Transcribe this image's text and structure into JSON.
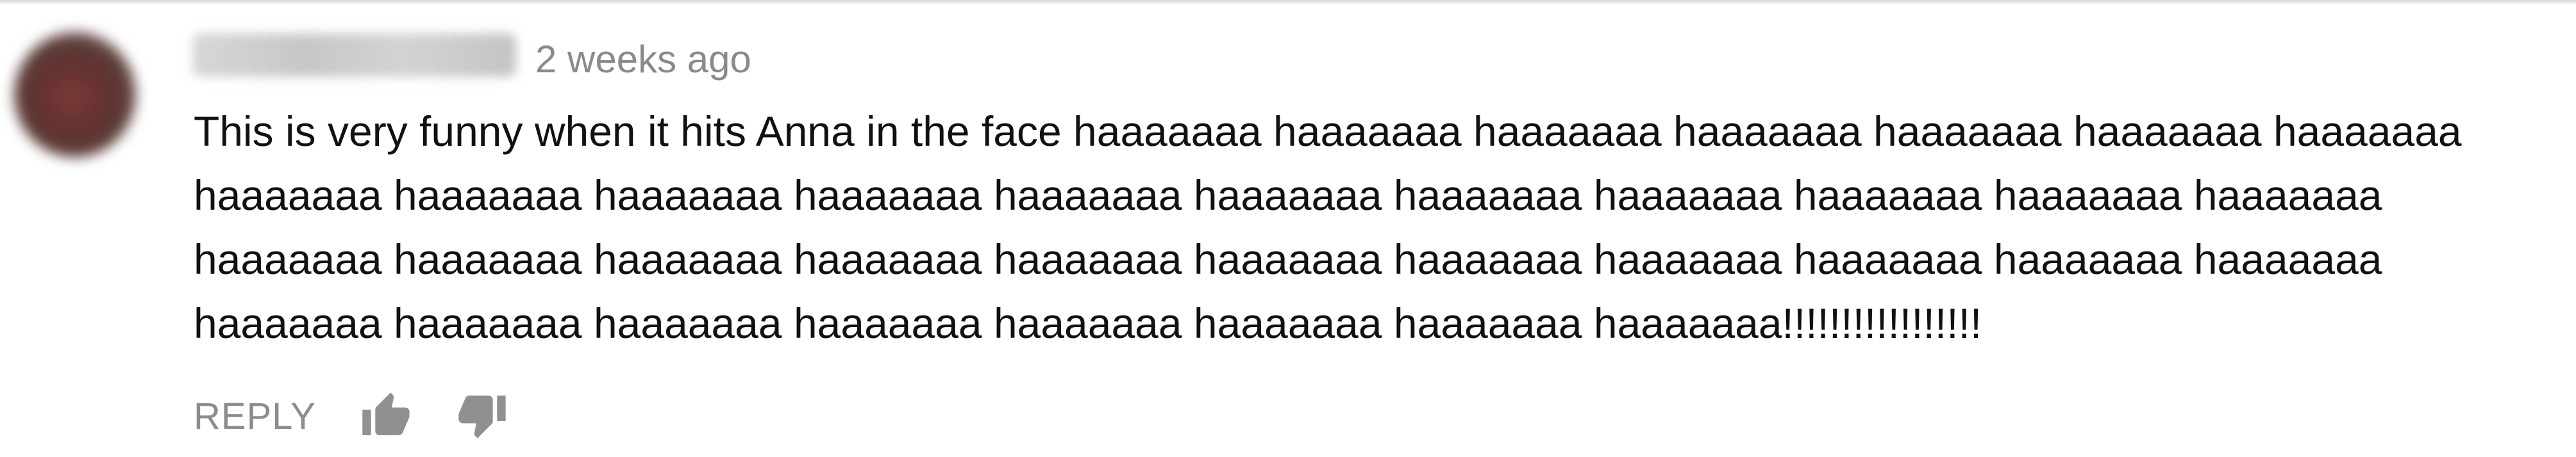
{
  "comment": {
    "timestamp": "2 weeks ago",
    "text_lines": [
      "This is very funny when it hits Anna in the face haaaaaaa haaaaaaa haaaaaaa haaaaaaa haaaaaaa haaaaaaa haaaaaaa",
      "haaaaaaa haaaaaaa haaaaaaa haaaaaaa haaaaaaa haaaaaaa haaaaaaa haaaaaaa haaaaaaa haaaaaaa haaaaaaa",
      "haaaaaaa haaaaaaa haaaaaaa haaaaaaa haaaaaaa haaaaaaa haaaaaaa haaaaaaa haaaaaaa haaaaaaa haaaaaaa",
      "haaaaaaa haaaaaaa haaaaaaa haaaaaaa haaaaaaa haaaaaaa haaaaaaa haaaaaaa!!!!!!!!!!!!!!!!!"
    ],
    "reply_label": "REPLY",
    "icons": {
      "like": "thumb-up-icon",
      "dislike": "thumb-down-icon"
    },
    "colors": {
      "text": "#111111",
      "meta": "#8a8a8a",
      "action": "#8c8c8c",
      "icon": "#909090"
    }
  }
}
